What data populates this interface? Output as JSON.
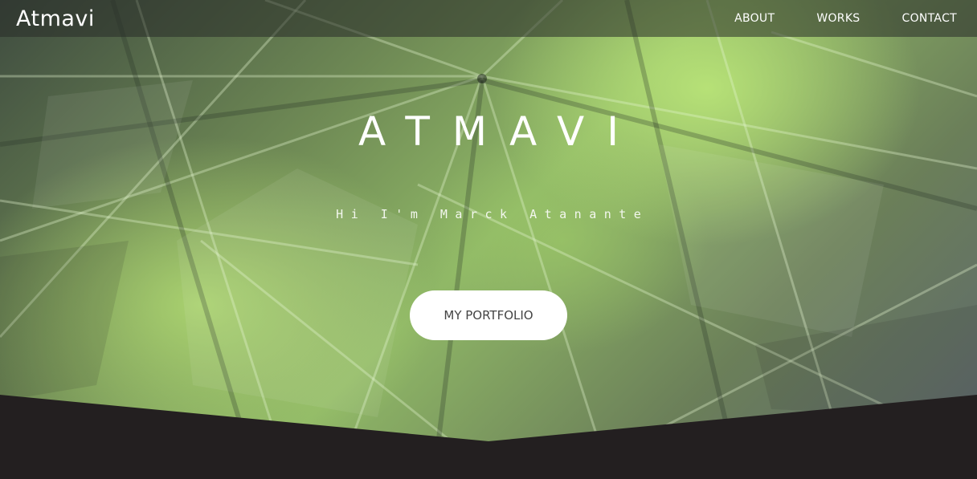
{
  "nav": {
    "brand": "Atmavi",
    "links": [
      "ABOUT",
      "WORKS",
      "CONTACT"
    ]
  },
  "hero": {
    "title": "ATMAVI",
    "subtitle": "Hi I'm Marck Atanante",
    "cta_label": "MY PORTFOLIO"
  },
  "colors": {
    "footer_band": "#231f20",
    "hero_accent": "#b2dc73",
    "button_bg": "#ffffff",
    "button_text": "#444444"
  }
}
